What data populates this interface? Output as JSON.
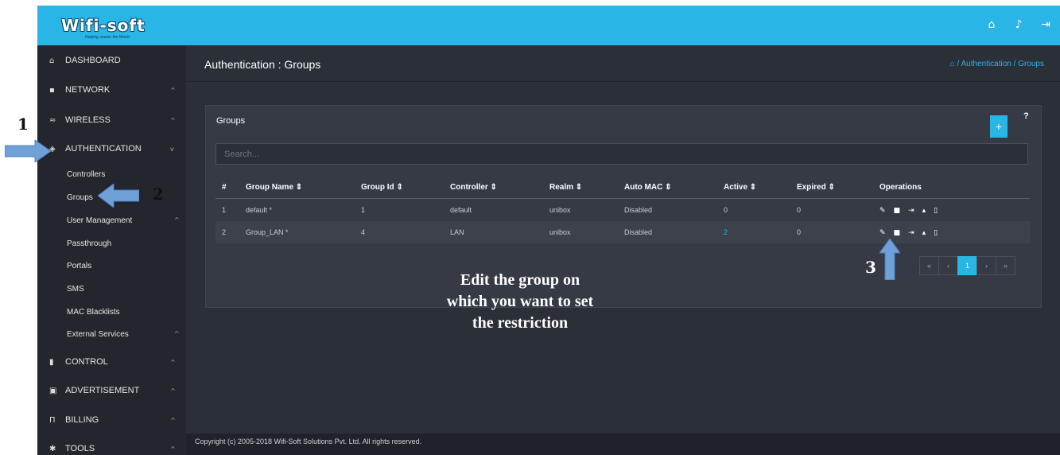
{
  "brand": {
    "logo": "Wifi-soft",
    "tagline": "Helping unwire the World"
  },
  "topbar_icons": [
    "home-icon",
    "bell-icon",
    "logout-icon"
  ],
  "sidebar": {
    "items": [
      {
        "label": "DASHBOARD",
        "icon": "home-icon"
      },
      {
        "label": "NETWORK",
        "icon": "network-icon",
        "chevron": "^"
      },
      {
        "label": "WIRELESS",
        "icon": "wifi-icon",
        "chevron": "^"
      },
      {
        "label": "AUTHENTICATION",
        "icon": "shield-icon",
        "chevron": "v"
      },
      {
        "label": "CONTROL",
        "icon": "control-icon",
        "chevron": "^"
      },
      {
        "label": "ADVERTISEMENT",
        "icon": "advertisement-icon",
        "chevron": "^"
      },
      {
        "label": "BILLING",
        "icon": "billing-icon",
        "chevron": "^"
      },
      {
        "label": "TOOLS",
        "icon": "gear-icon",
        "chevron": "^"
      }
    ],
    "sub_items": [
      {
        "label": "Controllers"
      },
      {
        "label": "Groups"
      },
      {
        "label": "User Management",
        "chevron": "^"
      },
      {
        "label": "Passthrough"
      },
      {
        "label": "Portals"
      },
      {
        "label": "SMS"
      },
      {
        "label": "MAC Blacklists"
      },
      {
        "label": "External Services",
        "chevron": "^"
      }
    ]
  },
  "page": {
    "title": "Authentication : Groups",
    "breadcrumb": "/ Authentication / Groups"
  },
  "panel": {
    "title": "Groups",
    "add_label": "+",
    "help_label": "?",
    "search_placeholder": "Search..."
  },
  "table": {
    "headers": [
      "#",
      "Group Name ⇕",
      "Group Id ⇕",
      "Controller ⇕",
      "Realm ⇕",
      "Auto MAC ⇕",
      "Active ⇕",
      "Expired ⇕",
      "Operations"
    ],
    "rows": [
      [
        "1",
        "default *",
        "1",
        "default",
        "unibox",
        "Disabled",
        "0",
        "0"
      ],
      [
        "2",
        "Group_LAN *",
        "4",
        "LAN",
        "unibox",
        "Disabled",
        "2",
        "0"
      ]
    ],
    "operation_icons": [
      "edit-icon",
      "trash-icon",
      "sign-out-icon",
      "unlock-icon",
      "document-icon"
    ]
  },
  "pager": {
    "items": [
      "«",
      "‹",
      "1",
      "›",
      "»"
    ],
    "active_page": "1"
  },
  "footer": {
    "copyright": "Copyright (c) 2005-2018 Wifi-Soft Solutions Pvt. Ltd. All rights reserved."
  },
  "annotations": {
    "step1": "1",
    "step2": "2",
    "step3": "3",
    "caption_lines": [
      "Edit the group on",
      "which you want to set",
      "the restriction"
    ]
  },
  "colors": {
    "accent": "#2ab5e7",
    "background": "#2b2f38",
    "sidebar": "#23262d",
    "panel": "#353a45",
    "arrow": "#6fa0d8"
  }
}
